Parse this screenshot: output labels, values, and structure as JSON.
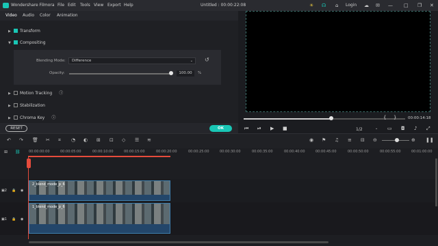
{
  "titlebar": {
    "app_name": "Wondershare Filmora",
    "menu": [
      "File",
      "Edit",
      "Tools",
      "View",
      "Export",
      "Help"
    ],
    "project_title": "Untitled : 00:00:22:08",
    "login": "Login"
  },
  "tabs": [
    "Video",
    "Audio",
    "Color",
    "Animation"
  ],
  "panel": {
    "transform": "Transform",
    "compositing": "Compositing",
    "blending_label": "Blending Mode:",
    "blending_value": "Difference",
    "opacity_label": "Opacity:",
    "opacity_value": "100.00",
    "opacity_unit": "%",
    "opacity_level": 1.0,
    "motion_tracking": "Motion Tracking",
    "stabilization": "Stabilization",
    "chroma_key": "Chroma Key"
  },
  "buttons": {
    "reset": "RESET",
    "ok": "OK"
  },
  "player": {
    "timecode": "00:00:14:18",
    "quality": "1/2",
    "progress": 0.54
  },
  "ruler": [
    "00:00:00:00",
    "00:00:05:00",
    "00:00:10:00",
    "00:00:15:00",
    "00:00:20:00",
    "00:00:25:00",
    "00:00:30:00",
    "00:00:35:00",
    "00:00:40:00",
    "00:00:45:00",
    "00:00:50:00",
    "00:00:55:00",
    "00:01:00:00"
  ],
  "tracks": {
    "clip1_label": "2_blend_mode_p_6",
    "clip2_label": "1_blend_mode_p_6"
  },
  "colors": {
    "accent": "#19c6b5",
    "playhead": "#e64b3c"
  }
}
